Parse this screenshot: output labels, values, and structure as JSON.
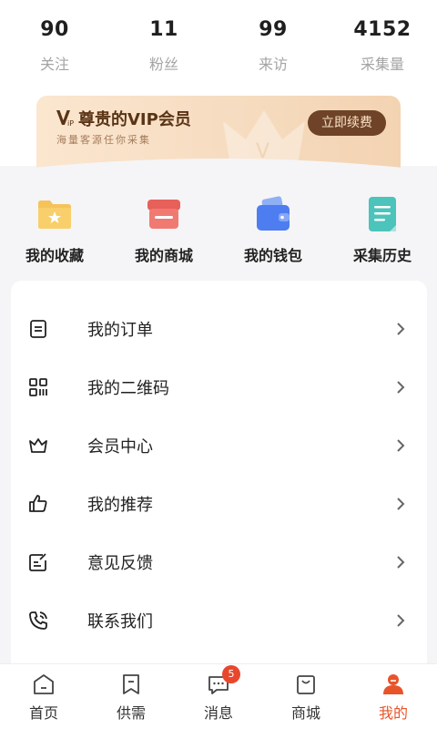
{
  "stats": [
    {
      "value": "90",
      "label": "关注"
    },
    {
      "value": "11",
      "label": "粉丝"
    },
    {
      "value": "99",
      "label": "来访"
    },
    {
      "value": "4152",
      "label": "采集量"
    }
  ],
  "vip": {
    "title": "尊贵的VIP会员",
    "subtitle": "海量客源任你采集",
    "button": "立即续费",
    "colors": {
      "card": "#f6dcc0",
      "button": "#6e4327",
      "title": "#5a3416"
    }
  },
  "quick_actions": [
    {
      "label": "我的收藏",
      "icon": "folder-star-icon"
    },
    {
      "label": "我的商城",
      "icon": "shop-icon"
    },
    {
      "label": "我的钱包",
      "icon": "wallet-icon"
    },
    {
      "label": "采集历史",
      "icon": "history-doc-icon"
    }
  ],
  "menu": [
    {
      "label": "我的订单",
      "icon": "order-icon"
    },
    {
      "label": "我的二维码",
      "icon": "qrcode-icon"
    },
    {
      "label": "会员中心",
      "icon": "crown-icon"
    },
    {
      "label": "我的推荐",
      "icon": "thumbs-up-icon"
    },
    {
      "label": "意见反馈",
      "icon": "feedback-icon"
    },
    {
      "label": "联系我们",
      "icon": "phone-icon"
    }
  ],
  "tabbar": {
    "items": [
      {
        "label": "首页",
        "icon": "home-icon"
      },
      {
        "label": "供需",
        "icon": "bookmark-icon"
      },
      {
        "label": "消息",
        "icon": "message-icon",
        "badge": "5"
      },
      {
        "label": "商城",
        "icon": "bag-icon"
      },
      {
        "label": "我的",
        "icon": "profile-icon",
        "active": true
      }
    ],
    "active_color": "#e8542a"
  }
}
